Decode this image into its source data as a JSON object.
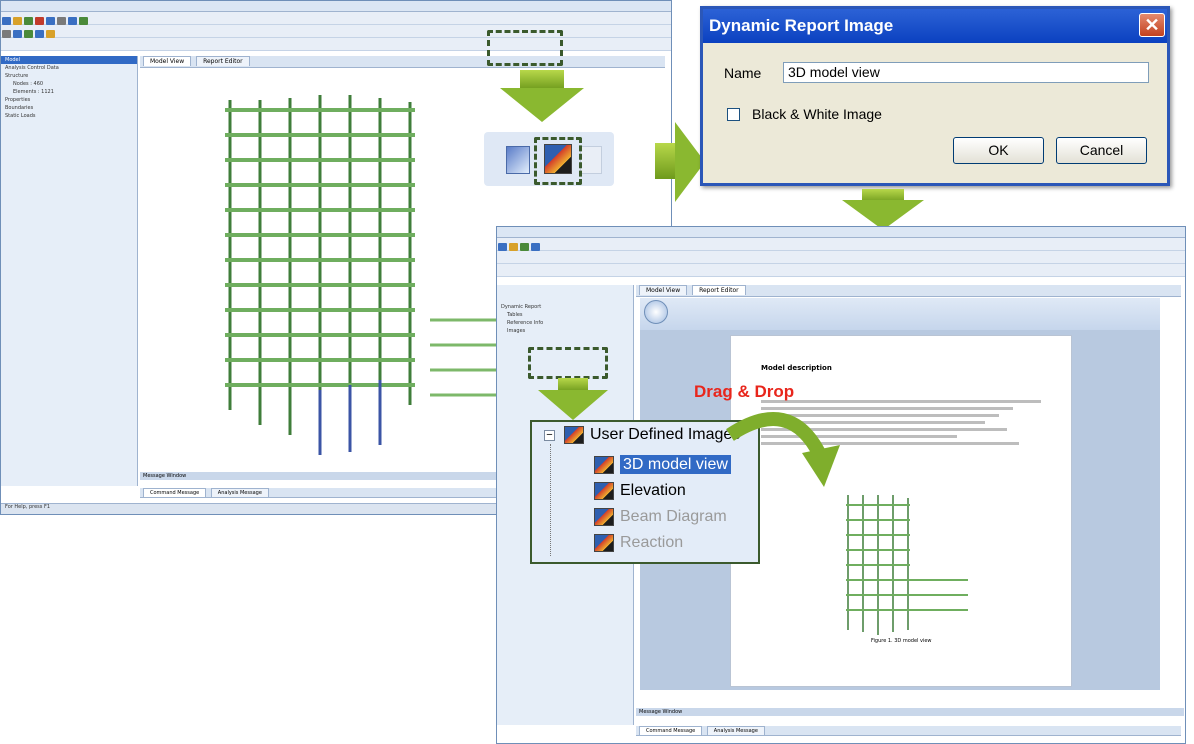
{
  "left_window": {
    "tabs": [
      "Model View",
      "Report Editor"
    ],
    "tree": [
      "Model",
      "Analysis Control Data",
      "Structure",
      "Nodes : 460",
      "Elements : 1121",
      "Properties",
      "Boundaries",
      "Static Loads"
    ],
    "message_panel": "Message Window",
    "message_tabs": [
      "Command Message",
      "Analysis Message"
    ],
    "status": "For Help, press F1"
  },
  "dialog": {
    "title": "Dynamic Report Image",
    "close_glyph": "✕",
    "name_label": "Name",
    "name_value": "3D model view",
    "checkbox_label": "Black & White Image",
    "ok_label": "OK",
    "cancel_label": "Cancel"
  },
  "right_window": {
    "tabs": [
      "Model View",
      "Report Editor"
    ],
    "tree_top": [
      "Dynamic Report",
      "Tables",
      "Reference Info",
      "Images"
    ],
    "doc_heading": "Model description",
    "doc_caption": "Figure 1. 3D model view"
  },
  "annotation": {
    "drag_drop": "Drag & Drop"
  },
  "zoom_tree": {
    "root": "User Defined Images",
    "expander": "−",
    "items": [
      {
        "label": "3D model view",
        "selected": true,
        "enabled": true
      },
      {
        "label": "Elevation",
        "selected": false,
        "enabled": true
      },
      {
        "label": "Beam Diagram",
        "selected": false,
        "enabled": false
      },
      {
        "label": "Reaction",
        "selected": false,
        "enabled": false
      }
    ]
  },
  "colors": {
    "accent_green": "#6e9a1c",
    "structure_green": "#3f7d3a",
    "dialog_title": "#0b41c0",
    "drag_text": "#e8261c",
    "selection": "#316ac5"
  }
}
